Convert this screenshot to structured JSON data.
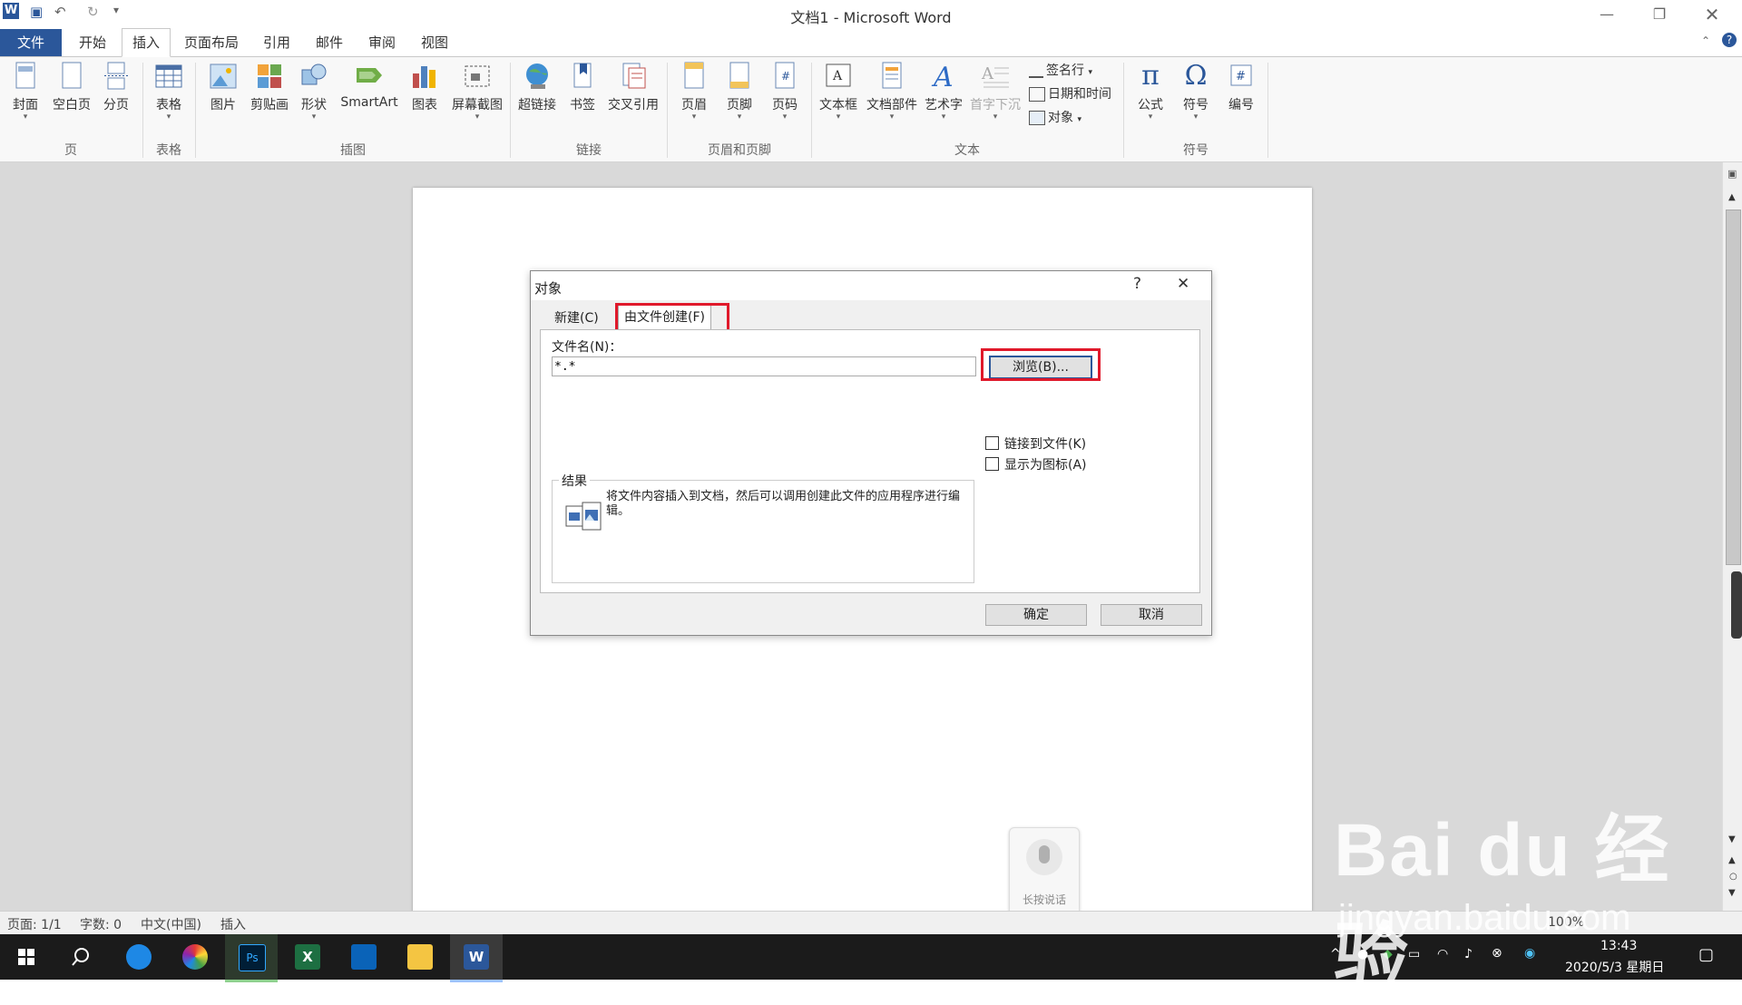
{
  "window": {
    "title": "文档1 - Microsoft Word",
    "app_icon": "W"
  },
  "quick_access": {
    "save_icon": "save-icon",
    "undo_icon": "undo-icon",
    "redo_icon": "redo-icon"
  },
  "tabs": [
    "文件",
    "开始",
    "插入",
    "页面布局",
    "引用",
    "邮件",
    "审阅",
    "视图"
  ],
  "active_tab": "插入",
  "ribbon": {
    "page_group": {
      "label": "页",
      "items": [
        "封面",
        "空白页",
        "分页"
      ]
    },
    "table_group": {
      "label": "表格",
      "items": [
        "表格"
      ]
    },
    "illus_group": {
      "label": "插图",
      "items": [
        "图片",
        "剪贴画",
        "形状",
        "SmartArt",
        "图表",
        "屏幕截图"
      ]
    },
    "link_group": {
      "label": "链接",
      "items": [
        "超链接",
        "书签",
        "交叉引用"
      ]
    },
    "hf_group": {
      "label": "页眉和页脚",
      "items": [
        "页眉",
        "页脚",
        "页码"
      ]
    },
    "text_group": {
      "label": "文本",
      "items": [
        "文本框",
        "文档部件",
        "艺术字",
        "首字下沉"
      ],
      "small": [
        "签名行",
        "日期和时间",
        "对象"
      ]
    },
    "symbol_group": {
      "label": "符号",
      "items": [
        "公式",
        "符号",
        "编号"
      ]
    }
  },
  "dialog": {
    "title": "对象",
    "help": "?",
    "close": "✕",
    "tabs": [
      "新建(C)",
      "由文件创建(F)"
    ],
    "filename_label": "文件名(N)：",
    "filename_value": "*.*",
    "browse": "浏览(B)...",
    "link_checkbox": "链接到文件(K)",
    "icon_checkbox": "显示为图标(A)",
    "result_label": "结果",
    "result_text": "将文件内容插入到文档，然后可以调用创建此文件的应用程序进行编辑。",
    "ok": "确定",
    "cancel": "取消"
  },
  "status": {
    "page": "页面: 1/1",
    "words": "字数: 0",
    "lang": "中文(中国)",
    "mode": "插入",
    "zoom": "100%"
  },
  "mic_widget": {
    "label": "长按说话"
  },
  "taskbar": {
    "time": "13:43",
    "date": "2020/5/3 星期日"
  },
  "watermark": {
    "line1": "Bai du 经验",
    "line2": "jingyan.baidu.com"
  },
  "colors": {
    "accent": "#2b579a",
    "highlight": "#e0192b"
  }
}
